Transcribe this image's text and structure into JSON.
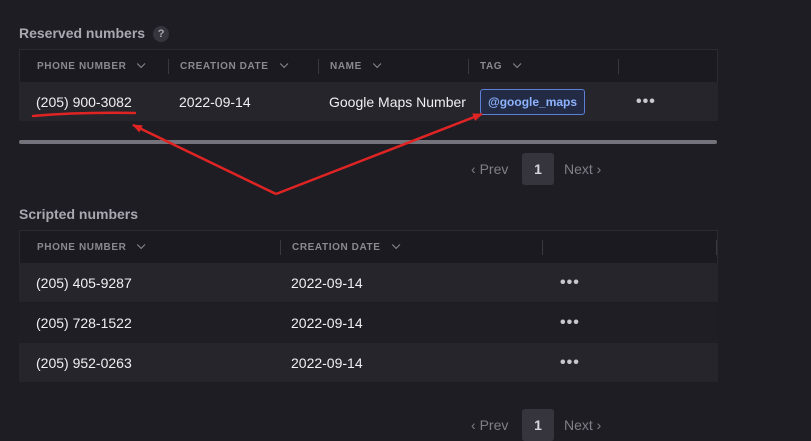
{
  "reserved": {
    "title": "Reserved numbers",
    "help_icon": "?",
    "columns": [
      "PHONE NUMBER",
      "CREATION DATE",
      "NAME",
      "TAG"
    ],
    "rows": [
      {
        "phone": "(205) 900-3082",
        "date": "2022-09-14",
        "name": "Google Maps Number",
        "tag": "@google_maps",
        "actions": "•••"
      }
    ],
    "pager": {
      "prev": "Prev",
      "page": "1",
      "next": "Next"
    }
  },
  "scripted": {
    "title": "Scripted numbers",
    "columns": [
      "PHONE NUMBER",
      "CREATION DATE"
    ],
    "rows": [
      {
        "phone": "(205) 405-9287",
        "date": "2022-09-14",
        "actions": "•••"
      },
      {
        "phone": "(205) 728-1522",
        "date": "2022-09-14",
        "actions": "•••"
      },
      {
        "phone": "(205) 952-0263",
        "date": "2022-09-14",
        "actions": "•••"
      }
    ],
    "pager": {
      "prev": "Prev",
      "page": "1",
      "next": "Next"
    }
  },
  "colors": {
    "annotation": "#e02424",
    "tag_border": "#5d7fd6",
    "tag_text": "#8db3ff"
  }
}
